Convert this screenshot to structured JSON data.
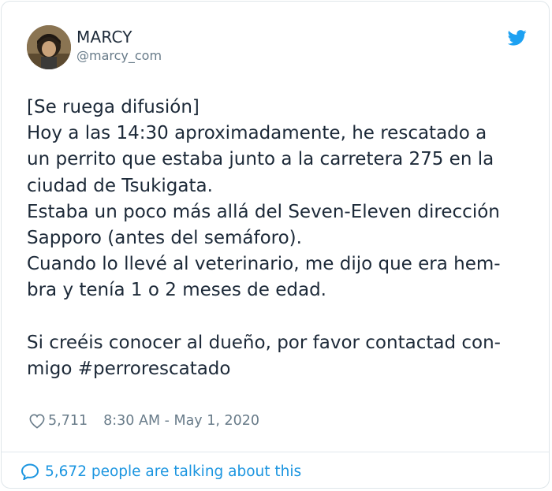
{
  "user": {
    "display_name": "MARCY",
    "handle": "@marcy_com",
    "avatar_icon": "profile-photo",
    "platform_icon": "twitter-bird-icon"
  },
  "tweet": {
    "lines": [
      "[Se ruega difusión]",
      "Hoy a las 14:30 aproximadamente, he rescatado a",
      "un perrito que estaba junto a la carretera 275 en la",
      "ciudad de Tsukigata.",
      "Estaba un poco más allá del Seven-Eleven dirección",
      "Sapporo (antes del semáforo).",
      "Cuando lo llevé al veterinario, me dijo que era hem-",
      "bra y tenía 1 o 2 meses de edad.",
      "",
      "Si creéis conocer al dueño, por favor contactad con-",
      "migo #perrorescatado"
    ]
  },
  "meta": {
    "likes": "5,711",
    "timestamp": "8:30 AM - May 1, 2020"
  },
  "footer": {
    "conversation_text": "5,672 people are talking about this"
  },
  "colors": {
    "text": "#1c2938",
    "secondary": "#687b89",
    "accent": "#1b95e0",
    "twitter_blue": "#1da1f2"
  }
}
